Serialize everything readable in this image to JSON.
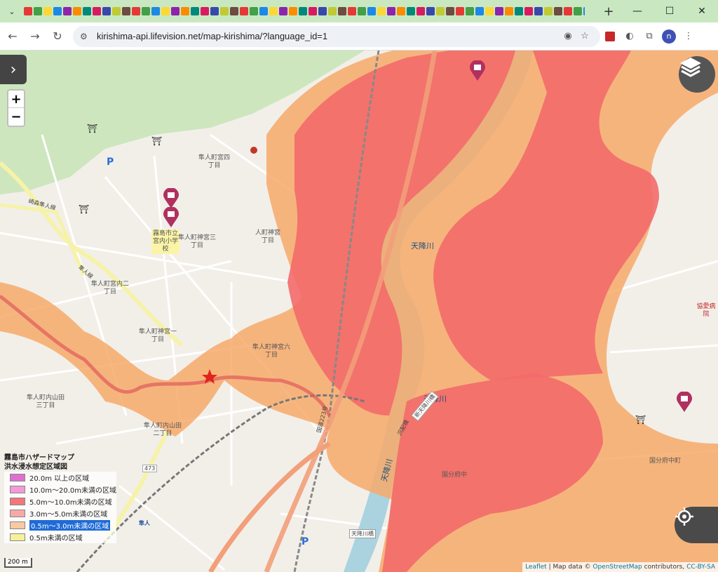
{
  "browser": {
    "tab_dropdown_icon": "chevron-down-icon",
    "new_tab_label": "+",
    "window_controls": {
      "minimize": "—",
      "maximize": "☐",
      "close": "✕"
    },
    "url": "kirishima-api.lifevision.net/map-kirishima/?language_id=1",
    "favicon_colors": [
      "#e53935",
      "#43a047",
      "#fdd835",
      "#1e88e5",
      "#8e24aa",
      "#fb8c00",
      "#00897b",
      "#d81b60",
      "#3949ab",
      "#c0ca33",
      "#6d4c41",
      "#e53935",
      "#43a047",
      "#1e88e5",
      "#fdd835",
      "#8e24aa",
      "#fb8c00",
      "#00897b",
      "#d81b60",
      "#3949ab",
      "#c0ca33",
      "#6d4c41",
      "#e53935",
      "#43a047",
      "#1e88e5",
      "#fdd835",
      "#8e24aa",
      "#fb8c00",
      "#00897b",
      "#d81b60",
      "#3949ab",
      "#c0ca33",
      "#6d4c41",
      "#e53935",
      "#43a047",
      "#1e88e5",
      "#fdd835",
      "#8e24aa",
      "#fb8c00",
      "#00897b",
      "#d81b60",
      "#3949ab",
      "#c0ca33",
      "#6d4c41",
      "#e53935",
      "#43a047",
      "#1e88e5",
      "#fdd835",
      "#8e24aa",
      "#fb8c00",
      "#00897b",
      "#d81b60",
      "#3949ab",
      "#c0ca33",
      "#6d4c41",
      "#e53935",
      "#43a047",
      "#1e88e5"
    ],
    "profile_initial": "n"
  },
  "map": {
    "zoom_in": "+",
    "zoom_out": "−",
    "sidebar_toggle": "›",
    "labels": [
      "隼人町宮四\n丁目",
      "霧島市立\n宮内小学\n校",
      "隼人町神宮三\n丁目",
      "人町神宮\n丁目",
      "隼人町宮内二\n丁目",
      "隼人町神宮一\n丁目",
      "隼人町神宮六\n丁目",
      "隼人町内山田\n三丁目",
      "隼人町内山田\n二丁目",
      "国分府中",
      "国分府中町",
      "協愛病院"
    ],
    "rivers": [
      "天降川",
      "天降川",
      "天降川"
    ],
    "roads": [
      "崎森隼人線",
      "隼人線",
      "国道223号",
      "473",
      "新天降川橋",
      "天降川橋",
      "沢配橋",
      "隼人"
    ],
    "legend": {
      "title": "霧島市ハザードマップ",
      "subtitle": "洪水浸水想定区域図",
      "items": [
        {
          "label": "20.0m 以上の区域",
          "color": "#e070d0"
        },
        {
          "label": "10.0m〜20.0m未満の区域",
          "color": "#f29ad6"
        },
        {
          "label": "5.0m〜10.0m未満の区域",
          "color": "#f3767a"
        },
        {
          "label": "3.0m〜5.0m未満の区域",
          "color": "#f7a8a8"
        },
        {
          "label": "0.5m〜3.0m未満の区域",
          "color": "#f9c9a0"
        },
        {
          "label": "0.5m未満の区域",
          "color": "#f6f09a"
        }
      ]
    },
    "scale": "200 m",
    "attribution": {
      "leaflet": "Leaflet",
      "mid": "| Map data ©",
      "osm": "OpenStreetMap",
      "contrib": "contributors,",
      "license": "CC-BY-SA"
    }
  }
}
